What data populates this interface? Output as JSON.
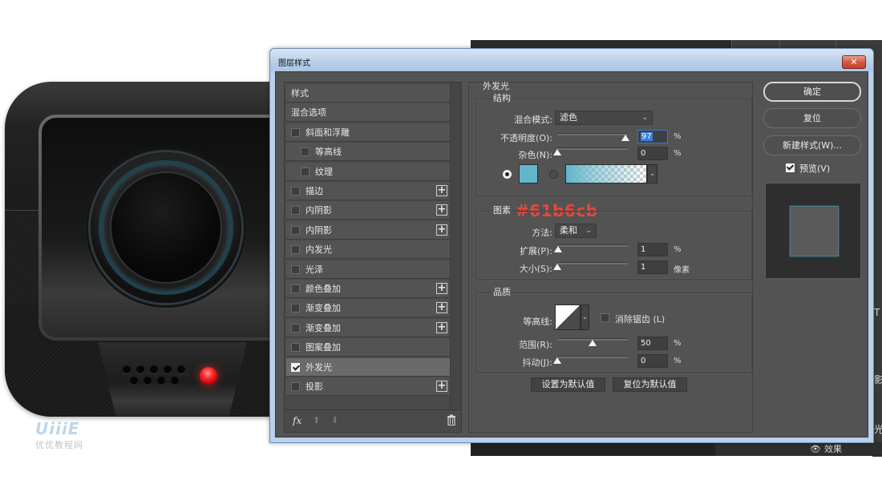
{
  "dialog": {
    "title": "图层样式",
    "close_label": "✕"
  },
  "style_list": {
    "items": [
      {
        "label": "样式",
        "has_checkbox": false,
        "checked": false,
        "has_plus": false,
        "indent": false
      },
      {
        "label": "混合选项",
        "has_checkbox": false,
        "checked": false,
        "has_plus": false,
        "indent": false
      },
      {
        "label": "斜面和浮雕",
        "has_checkbox": true,
        "checked": false,
        "has_plus": false,
        "indent": false
      },
      {
        "label": "等高线",
        "has_checkbox": true,
        "checked": false,
        "has_plus": false,
        "indent": true
      },
      {
        "label": "纹理",
        "has_checkbox": true,
        "checked": false,
        "has_plus": false,
        "indent": true
      },
      {
        "label": "描边",
        "has_checkbox": true,
        "checked": false,
        "has_plus": true,
        "indent": false
      },
      {
        "label": "内阴影",
        "has_checkbox": true,
        "checked": false,
        "has_plus": true,
        "indent": false
      },
      {
        "label": "内阴影",
        "has_checkbox": true,
        "checked": false,
        "has_plus": true,
        "indent": false
      },
      {
        "label": "内发光",
        "has_checkbox": true,
        "checked": false,
        "has_plus": false,
        "indent": false
      },
      {
        "label": "光泽",
        "has_checkbox": true,
        "checked": false,
        "has_plus": false,
        "indent": false
      },
      {
        "label": "颜色叠加",
        "has_checkbox": true,
        "checked": false,
        "has_plus": true,
        "indent": false
      },
      {
        "label": "渐变叠加",
        "has_checkbox": true,
        "checked": false,
        "has_plus": true,
        "indent": false
      },
      {
        "label": "渐变叠加",
        "has_checkbox": true,
        "checked": false,
        "has_plus": true,
        "indent": false
      },
      {
        "label": "图案叠加",
        "has_checkbox": true,
        "checked": false,
        "has_plus": false,
        "indent": false
      },
      {
        "label": "外发光",
        "has_checkbox": true,
        "checked": true,
        "has_plus": false,
        "indent": false,
        "active": true
      },
      {
        "label": "投影",
        "has_checkbox": true,
        "checked": false,
        "has_plus": true,
        "indent": false
      }
    ],
    "footer": {
      "fx_label": "fx",
      "up_arrow": "⬆",
      "down_arrow": "⬇"
    }
  },
  "outer_glow": {
    "title": "外发光",
    "structure": {
      "title": "结构",
      "blend_mode_label": "混合模式:",
      "blend_mode_value": "滤色",
      "opacity_label": "不透明度(O):",
      "opacity_value": "97",
      "opacity_unit": "%",
      "opacity_percent": 97,
      "noise_label": "杂色(N):",
      "noise_value": "0",
      "noise_unit": "%",
      "noise_percent": 0,
      "color_mode": "solid",
      "glow_color": "#61b6cb"
    },
    "annotation": "#61b6cb",
    "elements": {
      "title": "图素",
      "technique_label": "方法:",
      "technique_value": "柔和",
      "spread_label": "扩展(P):",
      "spread_value": "1",
      "spread_unit": "%",
      "spread_percent": 1,
      "size_label": "大小(S):",
      "size_value": "1",
      "size_unit": "像素",
      "size_fraction": 0.004
    },
    "quality": {
      "title": "品质",
      "contour_label": "等高线:",
      "antialias_label": "消除锯齿 (L)",
      "antialias_checked": false,
      "range_label": "范围(R):",
      "range_value": "50",
      "range_unit": "%",
      "range_percent": 50,
      "jitter_label": "抖动(J):",
      "jitter_value": "0",
      "jitter_unit": "%",
      "jitter_percent": 0
    },
    "make_default_label": "设置为默认值",
    "reset_default_label": "复位为默认值"
  },
  "actions": {
    "ok_label": "确定",
    "reset_label": "复位",
    "new_style_label": "新建样式(W)...",
    "preview_label": "预览(V)",
    "preview_checked": true
  },
  "workspace": {
    "effects_label": "效果",
    "right_edge_glyphs": [
      "T",
      "影",
      "光"
    ]
  },
  "artwork": {
    "watermark_logo": "UiiiE",
    "watermark_text": "优优教程网"
  },
  "colors": {
    "glow": "#61b6cb",
    "annotation": "#e8473a",
    "panel": "#535353"
  }
}
